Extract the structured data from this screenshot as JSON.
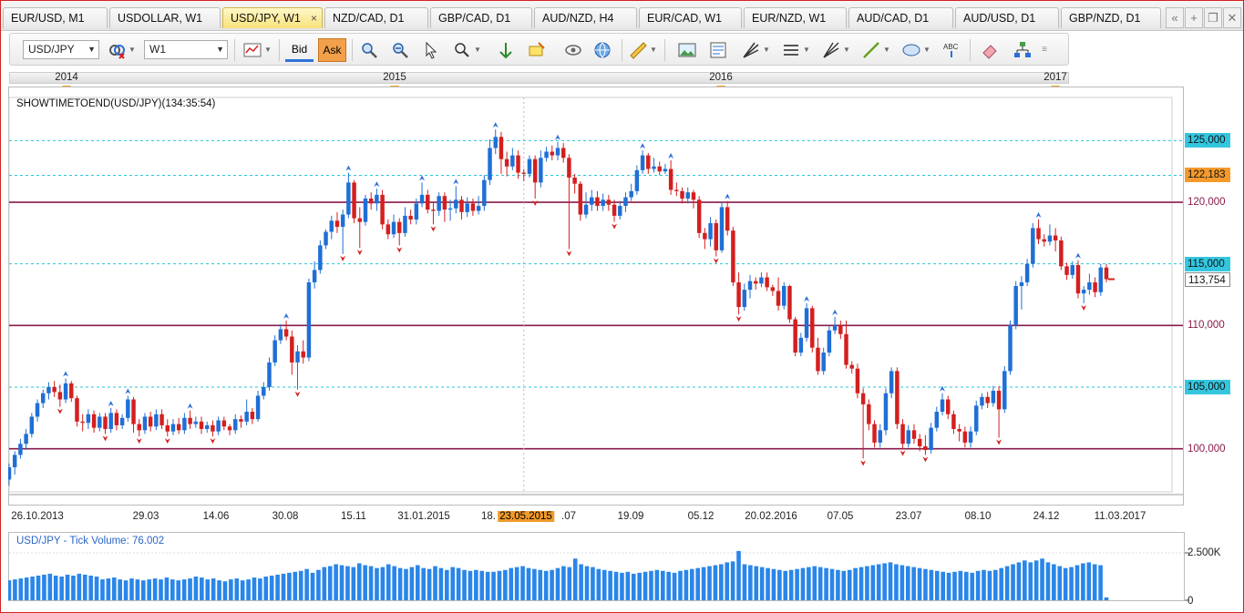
{
  "tabs": [
    {
      "label": "EUR/USD, M1",
      "active": false
    },
    {
      "label": "USDOLLAR, W1",
      "active": false
    },
    {
      "label": "USD/JPY, W1",
      "active": true
    },
    {
      "label": "NZD/CAD, D1",
      "active": false
    },
    {
      "label": "GBP/CAD, D1",
      "active": false
    },
    {
      "label": "AUD/NZD, H4",
      "active": false
    },
    {
      "label": "EUR/CAD, W1",
      "active": false
    },
    {
      "label": "EUR/NZD, W1",
      "active": false
    },
    {
      "label": "AUD/CAD, D1",
      "active": false
    },
    {
      "label": "AUD/USD, D1",
      "active": false
    },
    {
      "label": "GBP/NZD, D1",
      "active": false
    }
  ],
  "tab_close_glyph": "×",
  "tab_controls": [
    "«",
    "+",
    "❐",
    "✕"
  ],
  "toolbar": {
    "symbol_value": "USD/JPY",
    "timeframe_value": "W1",
    "bid_label": "Bid",
    "ask_label": "Ask"
  },
  "timeline": {
    "years": [
      "2014",
      "2015",
      "2016",
      "2017"
    ]
  },
  "indicator_label": "SHOWTIMETOEND(USD/JPY)(134:35:54)",
  "price_axis": {
    "levels": [
      "125,000",
      "122,183",
      "120,000",
      "115,000",
      "113,754",
      "110,000",
      "105,000",
      "100,000"
    ],
    "current_price": "122,183",
    "last_price": "113,754"
  },
  "x_axis_labels": [
    "26.10.2013",
    "29.03",
    "14.06",
    "30.08",
    "15.11",
    "31.01.2015",
    "18.",
    "23.05.2015",
    ".07",
    "19.09",
    "05.12",
    "20.02.2016",
    "07.05",
    "23.07",
    "08.10",
    "24.12",
    "11.03.2017"
  ],
  "crosshair_label": "23.05.2015",
  "volume_panel": {
    "title": "USD/JPY - Tick Volume: 76.002",
    "axis_labels": [
      "2.500K",
      "0"
    ]
  },
  "colors": {
    "bull": "#1f6fd6",
    "bear": "#d41f1f",
    "horizontal_line": "#8a1a4a",
    "dotted_line": "#29c6d6",
    "current_price_bg": "#f49a2c",
    "level_bg": "#34c6df",
    "volume": "#2a86e8"
  },
  "chart_data": {
    "type": "candlestick",
    "symbol": "USD/JPY",
    "timeframe": "W1",
    "ylim": [
      96.5,
      128.5
    ],
    "horizontal_lines": [
      120.0,
      110.0,
      100.0
    ],
    "dotted_levels": [
      125.0,
      122.183,
      115.0,
      105.0
    ],
    "last_price": 113.754,
    "candles": [
      [
        97.5,
        98.5,
        97.0,
        98.8
      ],
      [
        98.5,
        99.5,
        97.9,
        99.8
      ],
      [
        99.5,
        100.4,
        99.2,
        100.8
      ],
      [
        100.4,
        101.2,
        99.9,
        101.6
      ],
      [
        101.2,
        102.6,
        100.9,
        102.9
      ],
      [
        102.6,
        103.7,
        102.2,
        104.0
      ],
      [
        103.7,
        104.5,
        103.3,
        104.8
      ],
      [
        104.5,
        105.0,
        104.0,
        105.4
      ],
      [
        105.0,
        104.6,
        104.2,
        105.5
      ],
      [
        104.6,
        104.0,
        103.4,
        105.2
      ],
      [
        104.0,
        105.3,
        103.7,
        105.7
      ],
      [
        105.3,
        104.1,
        103.8,
        105.5
      ],
      [
        104.1,
        102.2,
        101.8,
        104.3
      ],
      [
        102.2,
        102.1,
        101.4,
        102.8
      ],
      [
        102.1,
        102.8,
        101.6,
        103.2
      ],
      [
        102.8,
        101.7,
        101.3,
        103.1
      ],
      [
        101.7,
        102.6,
        101.4,
        102.9
      ],
      [
        102.6,
        101.6,
        101.2,
        102.9
      ],
      [
        101.6,
        102.9,
        101.3,
        103.3
      ],
      [
        102.9,
        101.9,
        101.5,
        103.2
      ],
      [
        101.9,
        102.5,
        101.6,
        102.8
      ],
      [
        102.5,
        104.0,
        102.2,
        104.3
      ],
      [
        104.0,
        102.0,
        101.3,
        104.2
      ],
      [
        102.0,
        101.5,
        101.0,
        102.4
      ],
      [
        101.5,
        102.6,
        101.2,
        102.9
      ],
      [
        102.6,
        101.8,
        101.4,
        103.0
      ],
      [
        101.8,
        102.8,
        101.5,
        103.2
      ],
      [
        102.8,
        101.9,
        101.6,
        103.2
      ],
      [
        101.9,
        101.4,
        101.0,
        102.4
      ],
      [
        101.4,
        102.0,
        101.1,
        102.4
      ],
      [
        102.0,
        101.5,
        101.2,
        102.5
      ],
      [
        101.5,
        102.5,
        101.2,
        102.9
      ],
      [
        102.5,
        102.0,
        101.6,
        103.1
      ],
      [
        102.0,
        102.2,
        101.7,
        102.6
      ],
      [
        102.2,
        101.6,
        101.2,
        102.6
      ],
      [
        101.6,
        101.9,
        101.3,
        102.2
      ],
      [
        101.9,
        101.4,
        101.0,
        102.3
      ],
      [
        101.4,
        102.3,
        101.1,
        102.6
      ],
      [
        102.3,
        101.8,
        101.5,
        102.6
      ],
      [
        101.8,
        101.5,
        101.1,
        102.0
      ],
      [
        101.5,
        102.4,
        101.2,
        102.8
      ],
      [
        102.4,
        102.2,
        101.7,
        102.7
      ],
      [
        102.2,
        103.0,
        101.9,
        104.0
      ],
      [
        103.0,
        102.4,
        102.0,
        103.3
      ],
      [
        102.4,
        104.3,
        102.2,
        104.7
      ],
      [
        104.3,
        105.0,
        104.0,
        105.4
      ],
      [
        105.0,
        107.0,
        104.7,
        107.4
      ],
      [
        107.0,
        108.8,
        106.7,
        109.2
      ],
      [
        108.8,
        109.7,
        108.5,
        110.1
      ],
      [
        109.7,
        109.1,
        108.8,
        110.4
      ],
      [
        109.1,
        107.0,
        106.0,
        109.6
      ],
      [
        107.0,
        107.9,
        104.8,
        108.4
      ],
      [
        107.9,
        107.4,
        106.9,
        108.8
      ],
      [
        107.4,
        113.5,
        107.1,
        113.8
      ],
      [
        113.5,
        114.5,
        113.0,
        115.2
      ],
      [
        114.5,
        116.5,
        114.2,
        116.9
      ],
      [
        116.5,
        117.6,
        116.2,
        117.8
      ],
      [
        117.6,
        118.5,
        117.0,
        118.9
      ],
      [
        118.5,
        118.0,
        117.5,
        119.2
      ],
      [
        118.0,
        119.0,
        115.8,
        119.4
      ],
      [
        119.0,
        121.6,
        118.7,
        122.4
      ],
      [
        121.6,
        118.7,
        118.3,
        121.8
      ],
      [
        118.7,
        118.4,
        116.3,
        119.6
      ],
      [
        118.4,
        120.3,
        118.1,
        120.6
      ],
      [
        120.3,
        119.9,
        119.4,
        120.8
      ],
      [
        119.9,
        120.6,
        119.3,
        121.1
      ],
      [
        120.6,
        118.2,
        117.8,
        121.0
      ],
      [
        118.2,
        117.4,
        117.0,
        118.6
      ],
      [
        117.4,
        118.4,
        117.1,
        119.0
      ],
      [
        118.4,
        117.5,
        116.5,
        118.7
      ],
      [
        117.5,
        118.9,
        117.2,
        119.6
      ],
      [
        118.9,
        118.6,
        118.2,
        119.4
      ],
      [
        118.6,
        119.9,
        118.2,
        120.3
      ],
      [
        119.9,
        120.6,
        119.6,
        121.6
      ],
      [
        120.6,
        119.4,
        119.1,
        121.0
      ],
      [
        119.4,
        119.3,
        118.2,
        120.0
      ],
      [
        119.3,
        120.5,
        118.9,
        120.8
      ],
      [
        120.5,
        119.4,
        118.4,
        120.8
      ],
      [
        119.4,
        119.5,
        118.5,
        120.2
      ],
      [
        119.5,
        120.2,
        119.1,
        121.3
      ],
      [
        120.2,
        119.2,
        118.6,
        120.5
      ],
      [
        119.2,
        119.9,
        118.8,
        120.4
      ],
      [
        119.9,
        119.3,
        118.9,
        120.3
      ],
      [
        119.3,
        119.7,
        119.0,
        120.5
      ],
      [
        119.7,
        121.8,
        119.3,
        122.2
      ],
      [
        121.8,
        124.4,
        121.4,
        125.1
      ],
      [
        124.4,
        125.3,
        123.9,
        125.9
      ],
      [
        125.3,
        123.5,
        122.3,
        125.7
      ],
      [
        123.5,
        122.9,
        122.1,
        124.1
      ],
      [
        122.9,
        123.8,
        122.6,
        124.4
      ],
      [
        123.8,
        122.4,
        121.9,
        124.2
      ],
      [
        122.4,
        122.3,
        121.7,
        122.7
      ],
      [
        122.3,
        123.5,
        122.0,
        123.8
      ],
      [
        123.5,
        121.6,
        120.3,
        123.8
      ],
      [
        121.6,
        123.6,
        121.2,
        124.2
      ],
      [
        123.6,
        124.1,
        123.3,
        124.5
      ],
      [
        124.1,
        123.8,
        123.4,
        124.6
      ],
      [
        123.8,
        124.4,
        123.4,
        124.9
      ],
      [
        124.4,
        123.6,
        123.2,
        124.8
      ],
      [
        123.6,
        122.0,
        116.2,
        123.9
      ],
      [
        122.0,
        121.5,
        120.7,
        122.3
      ],
      [
        121.5,
        119.0,
        118.5,
        121.7
      ],
      [
        119.0,
        119.8,
        118.7,
        120.8
      ],
      [
        119.8,
        120.4,
        119.3,
        121.0
      ],
      [
        120.4,
        119.7,
        119.3,
        120.9
      ],
      [
        119.7,
        120.2,
        119.3,
        120.7
      ],
      [
        120.2,
        119.8,
        119.3,
        120.6
      ],
      [
        119.8,
        118.9,
        118.4,
        120.2
      ],
      [
        118.9,
        119.7,
        118.6,
        120.1
      ],
      [
        119.7,
        120.4,
        119.2,
        120.8
      ],
      [
        120.4,
        120.9,
        120.1,
        121.5
      ],
      [
        120.9,
        122.6,
        120.6,
        123.0
      ],
      [
        122.6,
        123.8,
        122.3,
        124.2
      ],
      [
        123.8,
        122.7,
        122.3,
        124.0
      ],
      [
        122.7,
        122.9,
        122.4,
        123.6
      ],
      [
        122.9,
        122.5,
        122.2,
        123.3
      ],
      [
        122.5,
        122.7,
        122.3,
        123.1
      ],
      [
        122.7,
        121.0,
        120.6,
        123.4
      ],
      [
        121.0,
        120.9,
        120.5,
        121.6
      ],
      [
        120.9,
        120.3,
        119.9,
        121.2
      ],
      [
        120.3,
        120.8,
        119.9,
        121.2
      ],
      [
        120.8,
        120.2,
        119.5,
        121.0
      ],
      [
        120.2,
        117.5,
        117.1,
        120.5
      ],
      [
        117.5,
        117.0,
        116.2,
        117.9
      ],
      [
        117.0,
        118.3,
        116.4,
        118.8
      ],
      [
        118.3,
        116.1,
        115.6,
        118.6
      ],
      [
        116.1,
        119.6,
        115.9,
        120.0
      ],
      [
        119.6,
        117.7,
        117.3,
        120.1
      ],
      [
        117.7,
        113.5,
        113.2,
        118.0
      ],
      [
        113.5,
        111.5,
        110.9,
        114.3
      ],
      [
        111.5,
        112.9,
        111.2,
        113.4
      ],
      [
        112.9,
        113.6,
        112.2,
        114.1
      ],
      [
        113.6,
        113.4,
        112.9,
        113.9
      ],
      [
        113.4,
        113.9,
        113.1,
        114.3
      ],
      [
        113.9,
        113.1,
        112.8,
        114.3
      ],
      [
        113.1,
        112.8,
        112.4,
        113.3
      ],
      [
        112.8,
        111.6,
        111.2,
        113.9
      ],
      [
        111.6,
        113.2,
        111.3,
        113.5
      ],
      [
        113.2,
        110.5,
        110.2,
        113.3
      ],
      [
        110.5,
        107.8,
        107.5,
        110.7
      ],
      [
        107.8,
        109.0,
        107.5,
        109.4
      ],
      [
        109.0,
        111.4,
        108.7,
        111.8
      ],
      [
        111.4,
        108.2,
        107.8,
        111.6
      ],
      [
        108.2,
        106.3,
        106.0,
        109.0
      ],
      [
        106.3,
        107.8,
        106.0,
        108.2
      ],
      [
        107.8,
        109.6,
        107.5,
        110.0
      ],
      [
        109.6,
        110.0,
        109.3,
        110.7
      ],
      [
        110.0,
        109.3,
        108.9,
        110.4
      ],
      [
        109.3,
        106.8,
        106.5,
        110.4
      ],
      [
        106.8,
        106.5,
        106.1,
        107.1
      ],
      [
        106.5,
        104.5,
        104.1,
        106.9
      ],
      [
        104.5,
        103.6,
        99.2,
        104.9
      ],
      [
        103.6,
        102.0,
        101.5,
        104.0
      ],
      [
        102.0,
        100.5,
        100.1,
        102.3
      ],
      [
        100.5,
        101.5,
        100.1,
        102.0
      ],
      [
        101.5,
        104.5,
        101.1,
        104.9
      ],
      [
        104.5,
        106.3,
        104.1,
        106.6
      ],
      [
        106.3,
        102.0,
        101.6,
        106.6
      ],
      [
        102.0,
        100.4,
        100.0,
        102.4
      ],
      [
        100.4,
        101.5,
        100.1,
        101.9
      ],
      [
        101.5,
        100.8,
        100.4,
        102.0
      ],
      [
        100.8,
        100.2,
        99.8,
        101.2
      ],
      [
        100.2,
        99.9,
        99.5,
        101.1
      ],
      [
        99.9,
        101.7,
        99.6,
        102.1
      ],
      [
        101.7,
        103.0,
        101.4,
        103.4
      ],
      [
        103.0,
        104.0,
        102.7,
        104.5
      ],
      [
        104.0,
        102.8,
        102.4,
        104.3
      ],
      [
        102.8,
        101.6,
        101.2,
        103.1
      ],
      [
        101.6,
        101.4,
        100.6,
        102.0
      ],
      [
        101.4,
        100.5,
        100.1,
        101.8
      ],
      [
        100.5,
        101.4,
        100.1,
        101.8
      ],
      [
        101.4,
        103.5,
        101.1,
        103.9
      ],
      [
        103.5,
        104.2,
        103.2,
        104.5
      ],
      [
        104.2,
        103.7,
        103.3,
        104.6
      ],
      [
        103.7,
        104.7,
        103.4,
        105.1
      ],
      [
        104.7,
        103.2,
        100.9,
        105.1
      ],
      [
        103.2,
        106.3,
        102.9,
        106.7
      ],
      [
        106.3,
        110.0,
        106.0,
        110.4
      ],
      [
        110.0,
        113.2,
        109.7,
        113.6
      ],
      [
        113.2,
        113.5,
        111.3,
        114.0
      ],
      [
        113.5,
        115.0,
        113.2,
        115.4
      ],
      [
        115.0,
        117.9,
        114.7,
        118.3
      ],
      [
        117.9,
        117.0,
        116.6,
        118.6
      ],
      [
        117.0,
        116.8,
        116.4,
        117.4
      ],
      [
        116.8,
        117.3,
        116.5,
        118.2
      ],
      [
        117.3,
        116.9,
        116.0,
        117.9
      ],
      [
        116.9,
        114.8,
        114.5,
        117.2
      ],
      [
        114.8,
        114.1,
        113.7,
        115.1
      ],
      [
        114.1,
        114.9,
        113.8,
        115.2
      ],
      [
        114.9,
        112.6,
        112.2,
        115.3
      ],
      [
        112.6,
        112.9,
        111.8,
        113.2
      ],
      [
        112.9,
        113.5,
        112.5,
        114.2
      ],
      [
        113.5,
        112.7,
        112.3,
        113.9
      ],
      [
        112.7,
        114.7,
        112.4,
        115.0
      ],
      [
        114.7,
        113.754,
        113.5,
        115.0
      ]
    ],
    "volume": [
      1.05,
      1.1,
      1.15,
      1.2,
      1.25,
      1.3,
      1.35,
      1.4,
      1.3,
      1.25,
      1.35,
      1.3,
      1.4,
      1.35,
      1.3,
      1.25,
      1.1,
      1.15,
      1.2,
      1.1,
      1.05,
      1.15,
      1.1,
      1.05,
      1.1,
      1.15,
      1.1,
      1.2,
      1.1,
      1.05,
      1.1,
      1.15,
      1.25,
      1.2,
      1.1,
      1.15,
      1.05,
      1.0,
      1.1,
      1.15,
      1.05,
      1.1,
      1.2,
      1.15,
      1.25,
      1.3,
      1.35,
      1.4,
      1.45,
      1.5,
      1.55,
      1.65,
      1.45,
      1.6,
      1.75,
      1.8,
      1.9,
      1.85,
      1.8,
      1.75,
      1.95,
      1.85,
      1.8,
      1.7,
      1.75,
      1.9,
      1.8,
      1.7,
      1.65,
      1.75,
      1.85,
      1.7,
      1.65,
      1.8,
      1.7,
      1.6,
      1.75,
      1.7,
      1.6,
      1.55,
      1.6,
      1.55,
      1.5,
      1.5,
      1.55,
      1.6,
      1.7,
      1.75,
      1.8,
      1.7,
      1.65,
      1.6,
      1.55,
      1.6,
      1.7,
      1.8,
      1.75,
      2.2,
      1.9,
      1.8,
      1.75,
      1.65,
      1.6,
      1.55,
      1.5,
      1.45,
      1.5,
      1.4,
      1.45,
      1.5,
      1.55,
      1.6,
      1.55,
      1.5,
      1.45,
      1.55,
      1.6,
      1.65,
      1.7,
      1.75,
      1.8,
      1.85,
      1.9,
      2.0,
      2.05,
      2.6,
      1.9,
      1.85,
      1.8,
      1.75,
      1.7,
      1.65,
      1.6,
      1.55,
      1.6,
      1.65,
      1.7,
      1.75,
      1.8,
      1.75,
      1.7,
      1.65,
      1.6,
      1.55,
      1.6,
      1.7,
      1.75,
      1.8,
      1.85,
      1.9,
      1.95,
      2.0,
      1.9,
      1.85,
      1.8,
      1.75,
      1.7,
      1.65,
      1.6,
      1.55,
      1.5,
      1.45,
      1.5,
      1.55,
      1.5,
      1.45,
      1.55,
      1.6,
      1.55,
      1.6,
      1.7,
      1.8,
      1.9,
      2.0,
      2.1,
      2.0,
      2.1,
      2.2,
      2.0,
      1.9,
      1.8,
      1.7,
      1.75,
      1.85,
      1.95,
      2.0,
      1.9,
      1.85,
      0.15
    ]
  }
}
